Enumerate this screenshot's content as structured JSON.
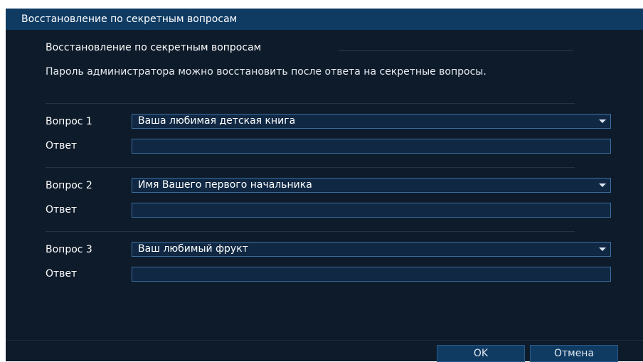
{
  "window": {
    "title": "Восстановление по секретным вопросам"
  },
  "section": {
    "title": "Восстановление по секретным вопросам",
    "description": "Пароль администратора можно восстановить после ответа на секретные вопросы."
  },
  "questions": [
    {
      "label": "Вопрос 1",
      "selected": "Ваша любимая детская книга",
      "answer_label": "Ответ",
      "answer_value": ""
    },
    {
      "label": "Вопрос 2",
      "selected": "Имя Вашего первого начальника",
      "answer_label": "Ответ",
      "answer_value": ""
    },
    {
      "label": "Вопрос 3",
      "selected": "Ваш любимый фрукт",
      "answer_label": "Ответ",
      "answer_value": ""
    }
  ],
  "buttons": {
    "ok": "OK",
    "cancel": "Отмена"
  },
  "colors": {
    "title_bar": "#0f3b63",
    "background": "#0d1b2a",
    "field_border": "#3b6e9f"
  }
}
